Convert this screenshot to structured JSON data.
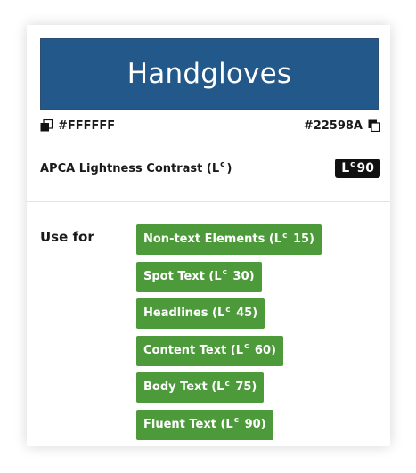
{
  "preview": {
    "text": "Handgloves",
    "text_color": "#FFFFFF",
    "background_color": "#22598A"
  },
  "swatches": {
    "foreground_label": "#FFFFFF",
    "background_label": "#22598A"
  },
  "apca": {
    "label_prefix": "APCA Lightness Contrast (L",
    "label_sup": "c",
    "label_suffix": ")",
    "badge_prefix": "L",
    "badge_sup": "c",
    "badge_value": "90"
  },
  "use_for": {
    "label": "Use for",
    "tag_color": "#4C9A3A",
    "tags": [
      {
        "prefix": "Non-text Elements (L",
        "sup": "c",
        "suffix": " 15)"
      },
      {
        "prefix": "Spot Text (L",
        "sup": "c",
        "suffix": " 30)"
      },
      {
        "prefix": "Headlines (L",
        "sup": "c",
        "suffix": " 45)"
      },
      {
        "prefix": "Content Text (L",
        "sup": "c",
        "suffix": " 60)"
      },
      {
        "prefix": "Body Text (L",
        "sup": "c",
        "suffix": " 75)"
      },
      {
        "prefix": "Fluent Text (L",
        "sup": "c",
        "suffix": " 90)"
      }
    ]
  }
}
